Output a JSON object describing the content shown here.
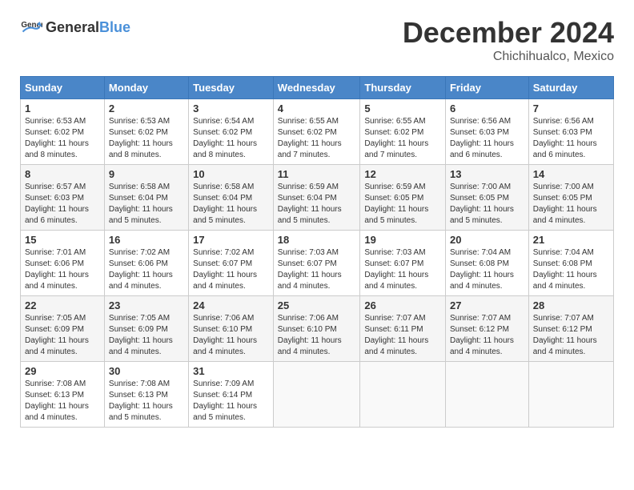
{
  "header": {
    "logo_general": "General",
    "logo_blue": "Blue",
    "month_title": "December 2024",
    "location": "Chichihualco, Mexico"
  },
  "calendar": {
    "weekdays": [
      "Sunday",
      "Monday",
      "Tuesday",
      "Wednesday",
      "Thursday",
      "Friday",
      "Saturday"
    ],
    "weeks": [
      [
        {
          "day": "1",
          "sunrise": "6:53 AM",
          "sunset": "6:02 PM",
          "daylight": "11 hours and 8 minutes."
        },
        {
          "day": "2",
          "sunrise": "6:53 AM",
          "sunset": "6:02 PM",
          "daylight": "11 hours and 8 minutes."
        },
        {
          "day": "3",
          "sunrise": "6:54 AM",
          "sunset": "6:02 PM",
          "daylight": "11 hours and 8 minutes."
        },
        {
          "day": "4",
          "sunrise": "6:55 AM",
          "sunset": "6:02 PM",
          "daylight": "11 hours and 7 minutes."
        },
        {
          "day": "5",
          "sunrise": "6:55 AM",
          "sunset": "6:02 PM",
          "daylight": "11 hours and 7 minutes."
        },
        {
          "day": "6",
          "sunrise": "6:56 AM",
          "sunset": "6:03 PM",
          "daylight": "11 hours and 6 minutes."
        },
        {
          "day": "7",
          "sunrise": "6:56 AM",
          "sunset": "6:03 PM",
          "daylight": "11 hours and 6 minutes."
        }
      ],
      [
        {
          "day": "8",
          "sunrise": "6:57 AM",
          "sunset": "6:03 PM",
          "daylight": "11 hours and 6 minutes."
        },
        {
          "day": "9",
          "sunrise": "6:58 AM",
          "sunset": "6:04 PM",
          "daylight": "11 hours and 5 minutes."
        },
        {
          "day": "10",
          "sunrise": "6:58 AM",
          "sunset": "6:04 PM",
          "daylight": "11 hours and 5 minutes."
        },
        {
          "day": "11",
          "sunrise": "6:59 AM",
          "sunset": "6:04 PM",
          "daylight": "11 hours and 5 minutes."
        },
        {
          "day": "12",
          "sunrise": "6:59 AM",
          "sunset": "6:05 PM",
          "daylight": "11 hours and 5 minutes."
        },
        {
          "day": "13",
          "sunrise": "7:00 AM",
          "sunset": "6:05 PM",
          "daylight": "11 hours and 5 minutes."
        },
        {
          "day": "14",
          "sunrise": "7:00 AM",
          "sunset": "6:05 PM",
          "daylight": "11 hours and 4 minutes."
        }
      ],
      [
        {
          "day": "15",
          "sunrise": "7:01 AM",
          "sunset": "6:06 PM",
          "daylight": "11 hours and 4 minutes."
        },
        {
          "day": "16",
          "sunrise": "7:02 AM",
          "sunset": "6:06 PM",
          "daylight": "11 hours and 4 minutes."
        },
        {
          "day": "17",
          "sunrise": "7:02 AM",
          "sunset": "6:07 PM",
          "daylight": "11 hours and 4 minutes."
        },
        {
          "day": "18",
          "sunrise": "7:03 AM",
          "sunset": "6:07 PM",
          "daylight": "11 hours and 4 minutes."
        },
        {
          "day": "19",
          "sunrise": "7:03 AM",
          "sunset": "6:07 PM",
          "daylight": "11 hours and 4 minutes."
        },
        {
          "day": "20",
          "sunrise": "7:04 AM",
          "sunset": "6:08 PM",
          "daylight": "11 hours and 4 minutes."
        },
        {
          "day": "21",
          "sunrise": "7:04 AM",
          "sunset": "6:08 PM",
          "daylight": "11 hours and 4 minutes."
        }
      ],
      [
        {
          "day": "22",
          "sunrise": "7:05 AM",
          "sunset": "6:09 PM",
          "daylight": "11 hours and 4 minutes."
        },
        {
          "day": "23",
          "sunrise": "7:05 AM",
          "sunset": "6:09 PM",
          "daylight": "11 hours and 4 minutes."
        },
        {
          "day": "24",
          "sunrise": "7:06 AM",
          "sunset": "6:10 PM",
          "daylight": "11 hours and 4 minutes."
        },
        {
          "day": "25",
          "sunrise": "7:06 AM",
          "sunset": "6:10 PM",
          "daylight": "11 hours and 4 minutes."
        },
        {
          "day": "26",
          "sunrise": "7:07 AM",
          "sunset": "6:11 PM",
          "daylight": "11 hours and 4 minutes."
        },
        {
          "day": "27",
          "sunrise": "7:07 AM",
          "sunset": "6:12 PM",
          "daylight": "11 hours and 4 minutes."
        },
        {
          "day": "28",
          "sunrise": "7:07 AM",
          "sunset": "6:12 PM",
          "daylight": "11 hours and 4 minutes."
        }
      ],
      [
        {
          "day": "29",
          "sunrise": "7:08 AM",
          "sunset": "6:13 PM",
          "daylight": "11 hours and 4 minutes."
        },
        {
          "day": "30",
          "sunrise": "7:08 AM",
          "sunset": "6:13 PM",
          "daylight": "11 hours and 5 minutes."
        },
        {
          "day": "31",
          "sunrise": "7:09 AM",
          "sunset": "6:14 PM",
          "daylight": "11 hours and 5 minutes."
        },
        null,
        null,
        null,
        null
      ]
    ]
  }
}
